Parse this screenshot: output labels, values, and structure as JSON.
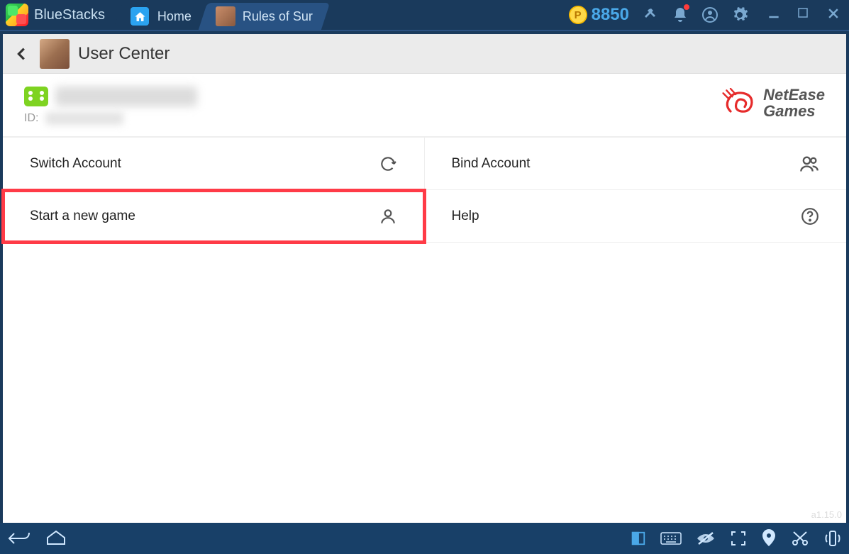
{
  "titlebar": {
    "app_name": "BlueStacks",
    "tabs": [
      {
        "label": "Home"
      },
      {
        "label": "Rules of Sur"
      }
    ],
    "coin_value": "8850"
  },
  "page": {
    "title": "User Center",
    "id_label": "ID:",
    "brand_line1": "NetEase",
    "brand_line2": "Games",
    "options": {
      "switch_account": "Switch Account",
      "start_new_game": "Start a new game",
      "bind_account": "Bind Account",
      "help": "Help"
    },
    "version": "a1.15.0"
  }
}
